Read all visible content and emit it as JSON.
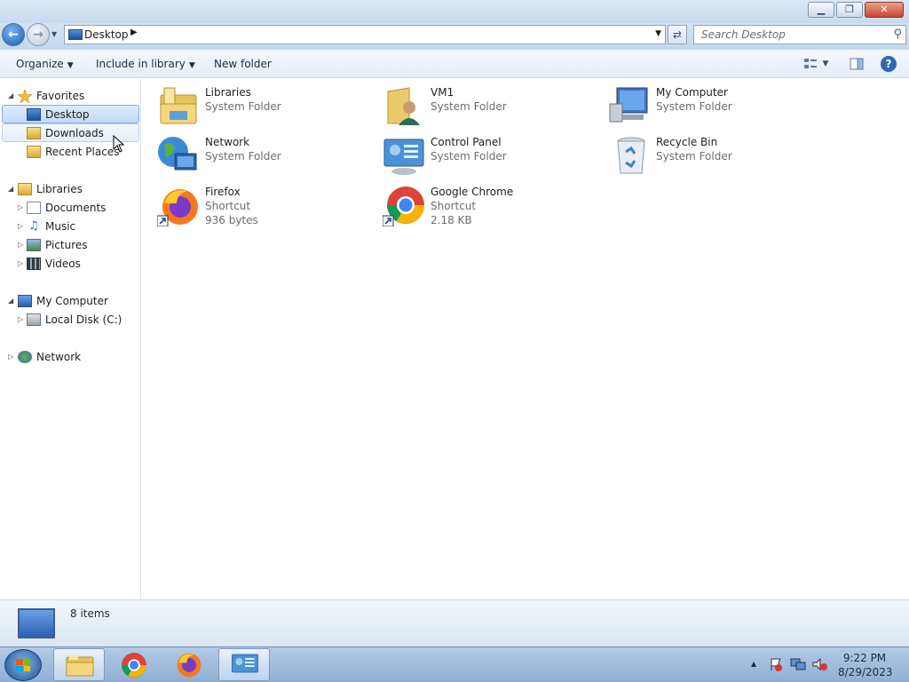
{
  "window": {
    "title": "Desktop",
    "controls": {
      "minimize": "▁",
      "restore": "❐",
      "close": "✕"
    }
  },
  "address": {
    "location": "Desktop",
    "separator": "▶",
    "search_placeholder": "Search Desktop"
  },
  "toolbar": {
    "organize": "Organize",
    "include_in_library": "Include in library",
    "new_folder": "New folder"
  },
  "nav": {
    "favorites": {
      "label": "Favorites",
      "items": [
        {
          "label": "Desktop",
          "icon": "desktop-icon"
        },
        {
          "label": "Downloads",
          "icon": "downloads-icon"
        },
        {
          "label": "Recent Places",
          "icon": "recent-places-icon"
        }
      ]
    },
    "libraries": {
      "label": "Libraries",
      "items": [
        {
          "label": "Documents",
          "icon": "documents-icon"
        },
        {
          "label": "Music",
          "icon": "music-icon"
        },
        {
          "label": "Pictures",
          "icon": "pictures-icon"
        },
        {
          "label": "Videos",
          "icon": "videos-icon"
        }
      ]
    },
    "computer": {
      "label": "My Computer",
      "items": [
        {
          "label": "Local Disk (C:)",
          "icon": "local-disk-icon"
        }
      ]
    },
    "network": {
      "label": "Network"
    }
  },
  "items": [
    {
      "name": "Libraries",
      "type": "System Folder",
      "icon": "libraries-icon"
    },
    {
      "name": "VM1",
      "type": "System Folder",
      "icon": "user-folder-icon"
    },
    {
      "name": "My Computer",
      "type": "System Folder",
      "icon": "computer-icon"
    },
    {
      "name": "Network",
      "type": "System Folder",
      "icon": "network-icon"
    },
    {
      "name": "Control Panel",
      "type": "System Folder",
      "icon": "control-panel-icon"
    },
    {
      "name": "Recycle Bin",
      "type": "System Folder",
      "icon": "recycle-bin-icon"
    },
    {
      "name": "Firefox",
      "type": "Shortcut",
      "size": "936 bytes",
      "icon": "firefox-icon"
    },
    {
      "name": "Google Chrome",
      "type": "Shortcut",
      "size": "2.18 KB",
      "icon": "chrome-icon"
    }
  ],
  "status": {
    "count": "8 items"
  },
  "taskbar": {
    "time": "9:22 PM",
    "date": "8/29/2023",
    "show_hidden": "▲"
  },
  "colors": {
    "selection": "#cce0f7",
    "selection_border": "#84acdd",
    "accent": "#2f67b6",
    "muted_text": "#6d6d6d"
  }
}
